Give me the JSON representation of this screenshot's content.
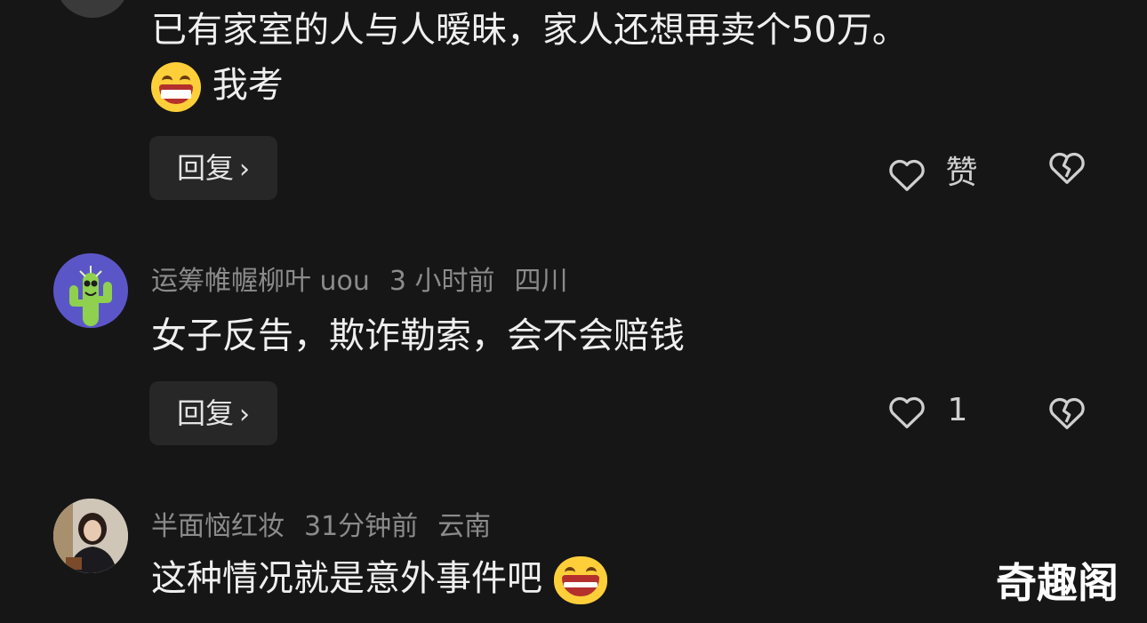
{
  "comments": [
    {
      "text_line1": "已有家室的人与人暧昧，家人还想再卖个50万。",
      "text_line2": "我考",
      "reply_label": "回复",
      "like_label": "赞"
    },
    {
      "username": "运筹帷幄柳叶 uou",
      "time": "3 小时前",
      "location": "四川",
      "text": "女子反告，欺诈勒索，会不会赔钱",
      "reply_label": "回复",
      "like_count": "1"
    },
    {
      "username": "半面恼红妆",
      "time": "31分钟前",
      "location": "云南",
      "text": "这种情况就是意外事件吧"
    }
  ],
  "watermark": "奇趣阁",
  "colors": {
    "background": "#161616",
    "meta_text": "#8b8b8b",
    "body_text": "#efefef",
    "reply_button_bg": "#272727",
    "avatar_purple": "#5b56c8",
    "cactus_green": "#8fd14f"
  },
  "icons": [
    "heart-outline-icon",
    "broken-heart-icon",
    "chevron-right-icon",
    "grinning-emoji",
    "laughing-emoji",
    "cactus-avatar"
  ]
}
